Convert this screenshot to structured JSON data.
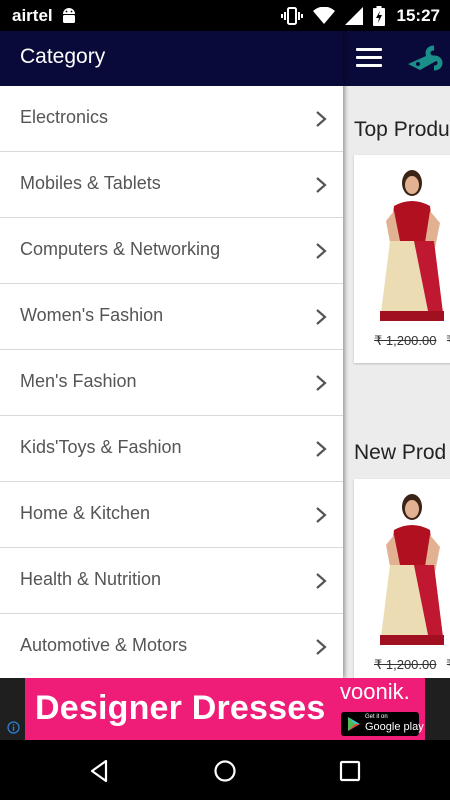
{
  "status_bar": {
    "carrier": "airtel",
    "time": "15:27",
    "icons": [
      "android-icon",
      "vibrate-icon",
      "wifi-icon",
      "signal-icon",
      "battery-charging-icon"
    ]
  },
  "drawer": {
    "title": "Category",
    "items": [
      {
        "label": "Electronics"
      },
      {
        "label": "Mobiles & Tablets"
      },
      {
        "label": "Computers & Networking"
      },
      {
        "label": "Women's Fashion"
      },
      {
        "label": "Men's Fashion"
      },
      {
        "label": "Kids'Toys & Fashion"
      },
      {
        "label": "Home & Kitchen"
      },
      {
        "label": "Health & Nutrition"
      },
      {
        "label": "Automotive & Motors"
      }
    ]
  },
  "main": {
    "sections": [
      {
        "title": "Top Produ",
        "price_old": "₹ 1,200.00",
        "price_cur": "₹"
      },
      {
        "title": "New Prod",
        "price_old": "₹ 1,200.00",
        "price_cur": "₹"
      }
    ]
  },
  "ad": {
    "headline": "Designer Dresses",
    "brand": "voonik.",
    "store_small": "Get it on",
    "store_big": "Google play"
  },
  "colors": {
    "app_bar": "#0a0a3a",
    "ad_background": "#f01d78",
    "logo_accent": "#1a8f8a"
  }
}
